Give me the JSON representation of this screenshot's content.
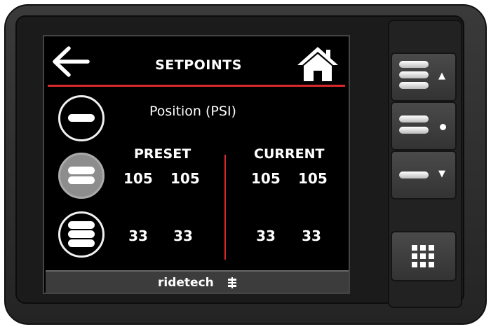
{
  "header": {
    "title": "SETPOINTS"
  },
  "measurement": {
    "label": "Position (PSI)"
  },
  "columns": {
    "preset": "PRESET",
    "current": "CURRENT"
  },
  "rows": [
    {
      "level": "mid",
      "preset": [
        "105",
        "105"
      ],
      "current": [
        "105",
        "105"
      ]
    },
    {
      "level": "low",
      "preset": [
        "33",
        "33"
      ],
      "current": [
        "33",
        "33"
      ]
    }
  ],
  "level_buttons": [
    {
      "name": "high",
      "pills": 1,
      "selected": false
    },
    {
      "name": "mid",
      "pills": 2,
      "selected": true
    },
    {
      "name": "low",
      "pills": 3,
      "selected": false
    }
  ],
  "brand": {
    "text": "ridetech"
  },
  "colors": {
    "accent": "#d8282c",
    "screen": "#000000",
    "selected": "#8d8d8d"
  },
  "icons": [
    "back-arrow-icon",
    "home-icon",
    "ridetech-logo-icon",
    "up-arrow-icon",
    "dot-icon",
    "down-arrow-icon",
    "grid-icon"
  ]
}
